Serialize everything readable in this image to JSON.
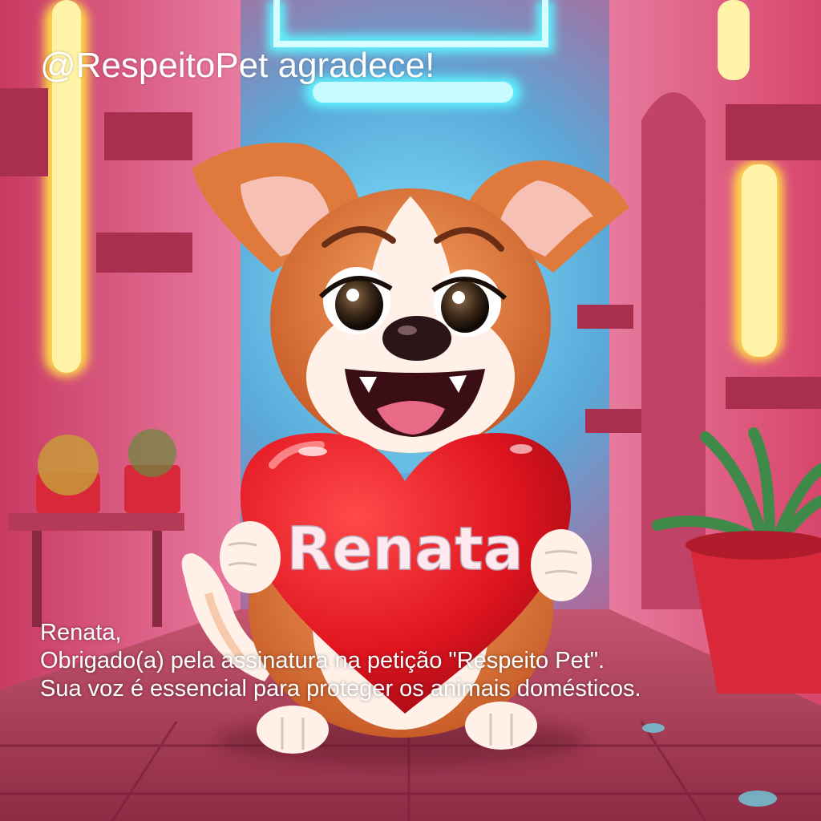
{
  "overlay": {
    "headline": "@RespeitoPet agradece!",
    "message_lines": [
      "Renata,",
      "Obrigado(a) pela assinatura na petição \"Respeito Pet\".",
      "Sua voz é essencial para proteger os animais domésticos."
    ]
  },
  "illustration": {
    "heart_text": "Renata",
    "subject": "cartoon-puppy-holding-heart",
    "setting": "neon-lit-pink-corridor"
  },
  "colors": {
    "wall_pink": "#d9577a",
    "neon_cyan": "#5ff3ff",
    "neon_yellow": "#ffe45a",
    "heart_red": "#e0141f",
    "fur_orange": "#e07a3c",
    "floor": "#b03a55",
    "text_white": "#ffffff"
  }
}
